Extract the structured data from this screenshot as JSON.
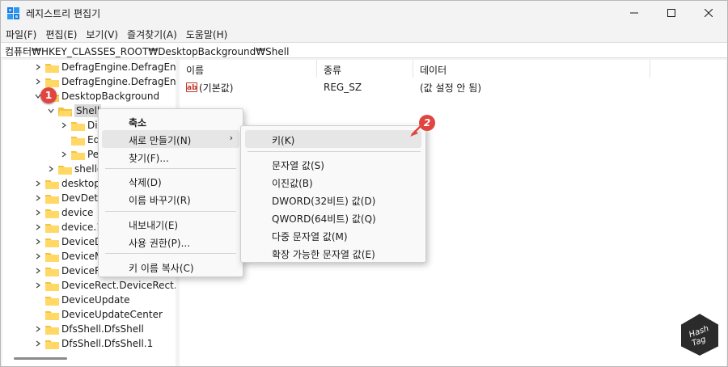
{
  "window": {
    "title": "레지스트리 편집기",
    "minimize_icon": "minimize-icon",
    "maximize_icon": "maximize-icon",
    "close_icon": "close-icon"
  },
  "menubar": [
    {
      "label": "파일(F)"
    },
    {
      "label": "편집(E)"
    },
    {
      "label": "보기(V)"
    },
    {
      "label": "즐겨찾기(A)"
    },
    {
      "label": "도움말(H)"
    }
  ],
  "address": "컴퓨터₩HKEY_CLASSES_ROOT₩DesktopBackground₩Shell",
  "tree": {
    "items": [
      {
        "label": "DefragEngine.DefragEn"
      },
      {
        "label": "DefragEngine.DefragEn"
      },
      {
        "label": "DesktopBackground"
      },
      {
        "label": "Shell"
      },
      {
        "label": "Di"
      },
      {
        "label": "Ed"
      },
      {
        "label": "Pe"
      },
      {
        "label": "shelle"
      },
      {
        "label": "desktopt"
      },
      {
        "label": "DevDeta"
      },
      {
        "label": "device"
      },
      {
        "label": "device.1"
      },
      {
        "label": "DeviceD"
      },
      {
        "label": "DeviceM"
      },
      {
        "label": "DeviceR"
      },
      {
        "label": "DeviceRect.DeviceRect."
      },
      {
        "label": "DeviceUpdate"
      },
      {
        "label": "DeviceUpdateCenter"
      },
      {
        "label": "DfsShell.DfsShell"
      },
      {
        "label": "DfsShell.DfsShell.1"
      }
    ]
  },
  "list": {
    "columns": [
      "이름",
      "종류",
      "데이터"
    ],
    "rows": [
      {
        "name": "(기본값)",
        "type": "REG_SZ",
        "data": "(값 설정 안 됨)",
        "icon": "ab-string-icon"
      }
    ]
  },
  "context_menu": {
    "items": [
      {
        "label": "축소",
        "bold": true
      },
      {
        "label": "새로 만들기(N)",
        "submenu": true
      },
      {
        "label": "찾기(F)..."
      },
      {
        "label": "삭제(D)"
      },
      {
        "label": "이름 바꾸기(R)"
      },
      {
        "label": "내보내기(E)"
      },
      {
        "label": "사용 권한(P)..."
      },
      {
        "label": "키 이름 복사(C)"
      }
    ]
  },
  "submenu": {
    "items": [
      {
        "label": "키(K)"
      },
      {
        "label": "문자열 값(S)"
      },
      {
        "label": "이진값(B)"
      },
      {
        "label": "DWORD(32비트) 값(D)"
      },
      {
        "label": "QWORD(64비트) 값(Q)"
      },
      {
        "label": "다중 문자열 값(M)"
      },
      {
        "label": "확장 가능한 문자열 값(E)"
      }
    ]
  },
  "badges": {
    "step1": "1",
    "step2": "2"
  },
  "watermark": {
    "line1": "Hash",
    "line2": "Tag"
  },
  "colors": {
    "badge": "#e0463f",
    "folder": "#f5c342"
  }
}
